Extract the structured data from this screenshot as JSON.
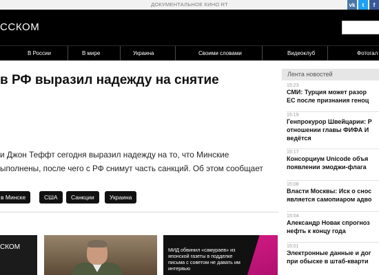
{
  "top_strip": {
    "promo": "ДОКУМЕНТАЛЬНОЕ КИНО RT"
  },
  "social": [
    {
      "glyph": "vk",
      "color": "#4a76a8"
    },
    {
      "glyph": "t",
      "color": "#1da1f2"
    },
    {
      "glyph": "f",
      "color": "#3b5998"
    }
  ],
  "header": {
    "logo": "ССКОМ",
    "search_placeholder": ""
  },
  "nav": [
    "В России",
    "В мире",
    "Украина",
    "Своими словами",
    "Видеоклуб",
    "Фотогал"
  ],
  "article": {
    "headline": "в РФ выразил надежду на снятие",
    "lede": [
      "и Джон Теффт сегодня выразил надежду на то, что Минские",
      "ыполнены, после чего с РФ снимут часть санкций. Об этом сообщает"
    ],
    "tags": [
      "в Минске",
      "США",
      "Санкции",
      "Украина"
    ]
  },
  "cards": {
    "first_logo": "СКОМ",
    "third_caption": "МИД обвинил «самураев» из японской газеты в подделке письма с советом не давать им интервью"
  },
  "sidebar": {
    "title": "Лента новостей",
    "items": [
      {
        "time": "15:23",
        "lines": [
          "СМИ: Турция может разор",
          "ЕС после признания геноц"
        ]
      },
      {
        "time": "15:19",
        "lines": [
          "Генпрокурор Швейцарии: Р",
          "отношении главы ФИФА И",
          "ведётся"
        ]
      },
      {
        "time": "15:17",
        "lines": [
          "Консорциум Unicode объя",
          "появлении эмоджи-флага"
        ]
      },
      {
        "time": "15:08",
        "lines": [
          "Власти Москвы: Иск о снос",
          "является самопиаром адво"
        ]
      },
      {
        "time": "15:04",
        "lines": [
          "Александр Новак спрогноз",
          "нефть к концу года"
        ]
      },
      {
        "time": "15:01",
        "lines": [
          "Электронные данные и дог",
          "при обыске в штаб-кварти"
        ]
      }
    ]
  },
  "colors": {
    "accent_pink": "#d11a82",
    "header_bg": "#000000",
    "tag_bg": "#111111"
  }
}
